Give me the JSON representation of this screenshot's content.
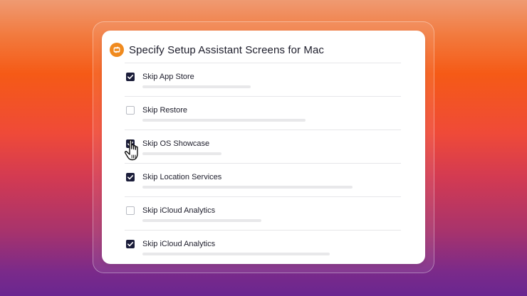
{
  "panel": {
    "title": "Specify Setup Assistant Screens for Mac",
    "icon": "sync-icon",
    "accent": "#f08a1e"
  },
  "items": [
    {
      "label": "Skip App Store",
      "checked": true
    },
    {
      "label": "Skip Restore",
      "checked": false
    },
    {
      "label": "Skip OS Showcase",
      "checked": true
    },
    {
      "label": "Skip Location Services",
      "checked": true
    },
    {
      "label": "Skip iCloud Analytics",
      "checked": false
    },
    {
      "label": "Skip iCloud Analytics",
      "checked": true
    }
  ],
  "cursor": {
    "icon": "hand-pointer-icon"
  }
}
